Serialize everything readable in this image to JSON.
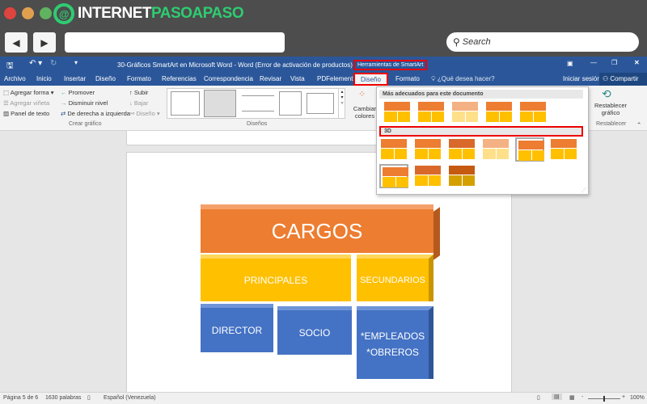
{
  "browser": {
    "logo_text_white": "INTERNET",
    "logo_text_green": "PASOAPASO",
    "search_placeholder": "Search",
    "back": "◀",
    "forward": "▶"
  },
  "word": {
    "title": "30-Gráficos SmartArt en Microsoft Word - Word (Error de activación de productos)",
    "context_tab": "Herramientas de SmartArt",
    "tabs": [
      "Archivo",
      "Inicio",
      "Insertar",
      "Diseño",
      "Formato",
      "Referencias",
      "Correspondencia",
      "Revisar",
      "Vista",
      "PDFelement",
      "Diseño",
      "Formato"
    ],
    "tell_me": "¿Qué desea hacer?",
    "sign_in": "Iniciar sesión",
    "share": "Compartir",
    "ribbon": {
      "crear": {
        "agregar_forma": "Agregar forma",
        "agregar_vineta": "Agregar viñeta",
        "panel_texto": "Panel de texto",
        "promover": "Promover",
        "disminuir": "Disminuir nivel",
        "derecha_izq": "De derecha a izquierda",
        "subir": "Subir",
        "bajar": "Bajar",
        "diseno": "Diseño",
        "label": "Crear gráfico"
      },
      "disenos_label": "Diseños",
      "cambiar_colores": "Cambiar colores",
      "restablecer": "Restablecer gráfico",
      "restablecer_label": "Restablecer"
    },
    "gallery": {
      "section1": "Más adecuados para este documento",
      "section2": "3D"
    },
    "smartart": {
      "top": "CARGOS",
      "row2": [
        "PRINCIPALES",
        "SECUNDARIOS"
      ],
      "row3": [
        "DIRECTOR",
        "SOCIO",
        "*EMPLEADOS *OBREROS"
      ],
      "colors": {
        "orange": "#ed7d31",
        "yellow": "#ffc000",
        "blue": "#4472c4"
      }
    },
    "status": {
      "page": "Página 5 de 6",
      "words": "1630 palabras",
      "language": "Español (Venezuela)",
      "zoom": "100%",
      "zoom_level": 100
    }
  }
}
